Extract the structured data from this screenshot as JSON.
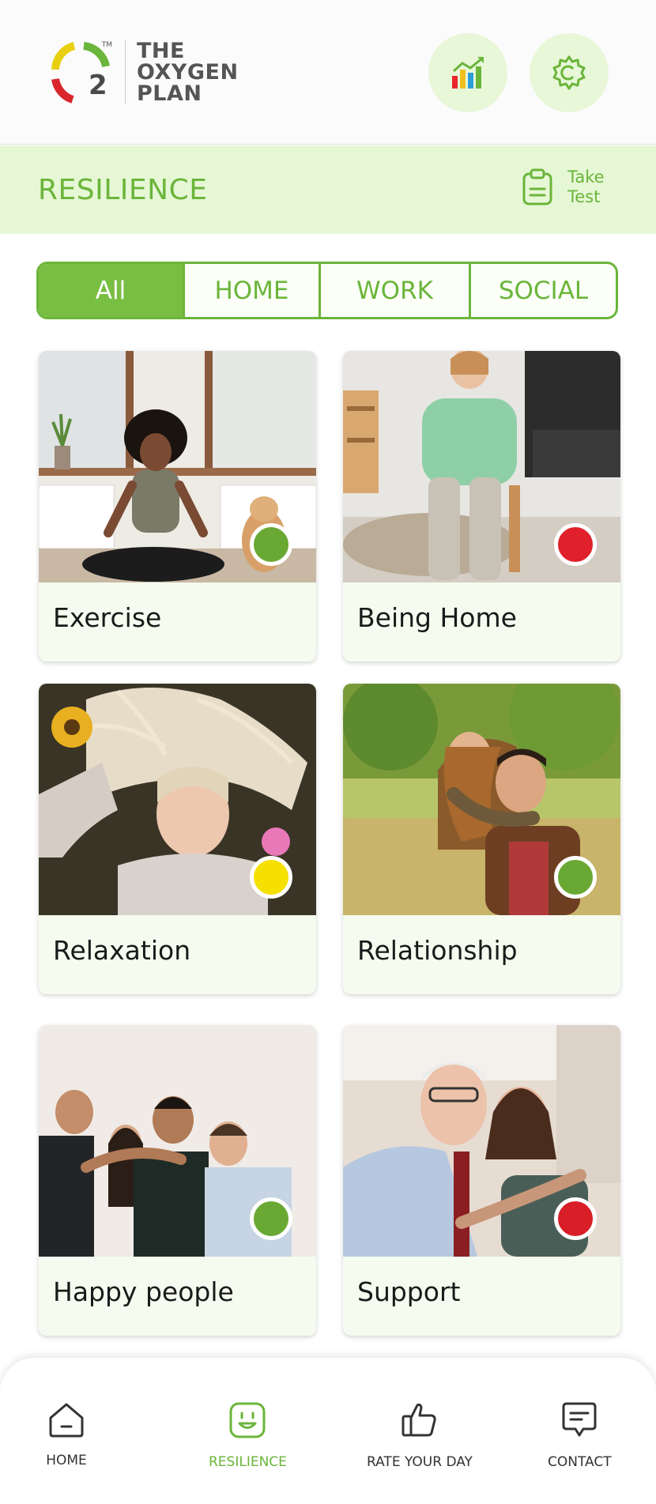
{
  "header": {
    "logo": {
      "trademark": "TM",
      "number": "2",
      "lines": [
        "THE",
        "OXYGEN",
        "PLAN"
      ]
    },
    "stats_icon": "bar-chart-icon",
    "settings_icon": "gear-icon"
  },
  "title_bar": {
    "title": "RESILIENCE",
    "take_test": {
      "line1": "Take",
      "line2": "Test",
      "icon": "clipboard-icon"
    }
  },
  "tabs": [
    {
      "label": "All",
      "active": true
    },
    {
      "label": "HOME",
      "active": false
    },
    {
      "label": "WORK",
      "active": false
    },
    {
      "label": "SOCIAL",
      "active": false
    }
  ],
  "cards": [
    {
      "label": "Exercise",
      "status_color": "#6aa834"
    },
    {
      "label": "Being Home",
      "status_color": "#e0202a"
    },
    {
      "label": "Relaxation",
      "status_color": "#f5e000"
    },
    {
      "label": "Relationship",
      "status_color": "#6aa834"
    },
    {
      "label": "Happy people",
      "status_color": "#6aa834"
    },
    {
      "label": "Support",
      "status_color": "#d81e26"
    }
  ],
  "bottom_nav": [
    {
      "label": "HOME",
      "icon": "home-icon",
      "active": false
    },
    {
      "label": "RESILIENCE",
      "icon": "smiley-icon",
      "active": true
    },
    {
      "label": "RATE YOUR DAY",
      "icon": "thumbs-up-icon",
      "active": false
    },
    {
      "label": "CONTACT",
      "icon": "chat-icon",
      "active": false
    }
  ],
  "colors": {
    "brand_green": "#6bb53a",
    "light_green": "#e6f7d6",
    "card_bg": "#f5fcef"
  }
}
